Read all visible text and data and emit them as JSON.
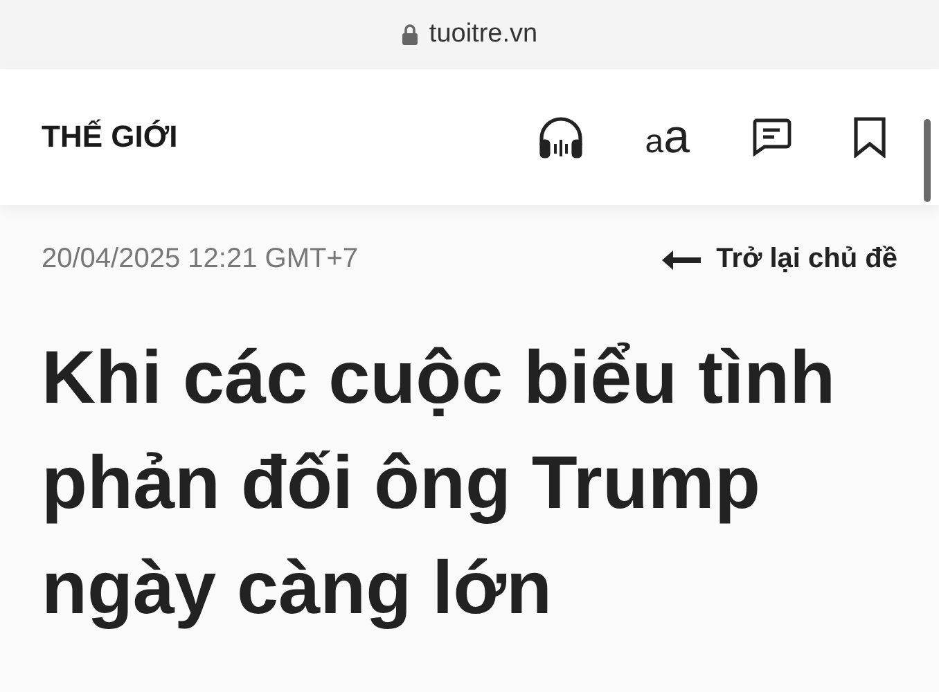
{
  "address_bar": {
    "url": "tuoitre.vn"
  },
  "header": {
    "section": "THẾ GIỚI",
    "font_button": {
      "small": "a",
      "large": "a"
    }
  },
  "article": {
    "timestamp": "20/04/2025 12:21 GMT+7",
    "back_link": "Trở lại chủ đề",
    "title": "Khi các cuộc biểu tình phản đối ông Trump ngày càng lớn"
  }
}
